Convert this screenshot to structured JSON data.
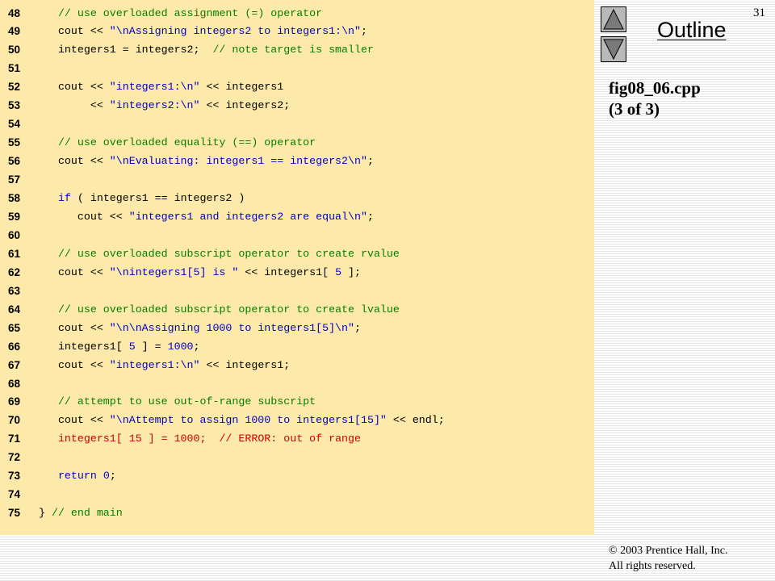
{
  "slide": {
    "page_number": "31",
    "outline_label": "Outline",
    "figure_name": "fig08_06.cpp",
    "figure_part": "(3 of 3)",
    "copyright_line1": "© 2003 Prentice Hall, Inc.",
    "copyright_line2": "All rights reserved.",
    "nav_up_icon": "triangle-up-icon",
    "nav_down_icon": "triangle-down-icon"
  },
  "code": [
    {
      "n": "48",
      "parts": [
        [
          "   ",
          ""
        ],
        [
          "// use overloaded assignment (=) operator",
          "cm"
        ]
      ]
    },
    {
      "n": "49",
      "parts": [
        [
          "   cout << ",
          ""
        ],
        [
          "\"\\nAssigning integers2 to integers1:\\n\"",
          "st"
        ],
        [
          ";",
          ""
        ]
      ]
    },
    {
      "n": "50",
      "parts": [
        [
          "   integers1 = integers2;  ",
          ""
        ],
        [
          "// note target is smaller",
          "cm"
        ]
      ]
    },
    {
      "n": "51",
      "parts": [
        [
          "",
          ""
        ]
      ]
    },
    {
      "n": "52",
      "parts": [
        [
          "   cout << ",
          ""
        ],
        [
          "\"integers1:\\n\"",
          "st"
        ],
        [
          " << integers1",
          ""
        ]
      ]
    },
    {
      "n": "53",
      "parts": [
        [
          "        << ",
          ""
        ],
        [
          "\"integers2:\\n\"",
          "st"
        ],
        [
          " << integers2;",
          ""
        ]
      ]
    },
    {
      "n": "54",
      "parts": [
        [
          "",
          ""
        ]
      ]
    },
    {
      "n": "55",
      "parts": [
        [
          "   ",
          ""
        ],
        [
          "// use overloaded equality (==) operator",
          "cm"
        ]
      ]
    },
    {
      "n": "56",
      "parts": [
        [
          "   cout << ",
          ""
        ],
        [
          "\"\\nEvaluating: integers1 == integers2\\n\"",
          "st"
        ],
        [
          ";",
          ""
        ]
      ]
    },
    {
      "n": "57",
      "parts": [
        [
          "",
          ""
        ]
      ]
    },
    {
      "n": "58",
      "parts": [
        [
          "   ",
          ""
        ],
        [
          "if",
          "kw"
        ],
        [
          " ( integers1 == integers2 )",
          ""
        ]
      ]
    },
    {
      "n": "59",
      "parts": [
        [
          "      cout << ",
          ""
        ],
        [
          "\"integers1 and integers2 are equal\\n\"",
          "st"
        ],
        [
          ";",
          ""
        ]
      ]
    },
    {
      "n": "60",
      "parts": [
        [
          "",
          ""
        ]
      ]
    },
    {
      "n": "61",
      "parts": [
        [
          "   ",
          ""
        ],
        [
          "// use overloaded subscript operator to create rvalue",
          "cm"
        ]
      ]
    },
    {
      "n": "62",
      "parts": [
        [
          "   cout << ",
          ""
        ],
        [
          "\"\\nintegers1[5] is \"",
          "st"
        ],
        [
          " << integers1[ ",
          ""
        ],
        [
          "5",
          "nm"
        ],
        [
          " ];",
          ""
        ]
      ]
    },
    {
      "n": "63",
      "parts": [
        [
          "",
          ""
        ]
      ]
    },
    {
      "n": "64",
      "parts": [
        [
          "   ",
          ""
        ],
        [
          "// use overloaded subscript operator to create lvalue",
          "cm"
        ]
      ]
    },
    {
      "n": "65",
      "parts": [
        [
          "   cout << ",
          ""
        ],
        [
          "\"\\n\\nAssigning 1000 to integers1[5]\\n\"",
          "st"
        ],
        [
          ";",
          ""
        ]
      ]
    },
    {
      "n": "66",
      "parts": [
        [
          "   integers1[ ",
          ""
        ],
        [
          "5",
          "nm"
        ],
        [
          " ] = ",
          ""
        ],
        [
          "1000",
          "nm"
        ],
        [
          ";",
          ""
        ]
      ]
    },
    {
      "n": "67",
      "parts": [
        [
          "   cout << ",
          ""
        ],
        [
          "\"integers1:\\n\"",
          "st"
        ],
        [
          " << integers1;",
          ""
        ]
      ]
    },
    {
      "n": "68",
      "parts": [
        [
          "",
          ""
        ]
      ]
    },
    {
      "n": "69",
      "parts": [
        [
          "   ",
          ""
        ],
        [
          "// attempt to use out-of-range subscript",
          "cm"
        ]
      ]
    },
    {
      "n": "70",
      "parts": [
        [
          "   cout << ",
          ""
        ],
        [
          "\"\\nAttempt to assign 1000 to integers1[15]\"",
          "st"
        ],
        [
          " << endl;",
          ""
        ]
      ]
    },
    {
      "n": "71",
      "parts": [
        [
          "   integers1[ 15 ] = 1000;  ",
          "er"
        ],
        [
          "// ERROR",
          "ec"
        ],
        [
          ": out of range",
          "er"
        ]
      ]
    },
    {
      "n": "72",
      "parts": [
        [
          "",
          ""
        ]
      ]
    },
    {
      "n": "73",
      "parts": [
        [
          "   ",
          ""
        ],
        [
          "return",
          "kw"
        ],
        [
          " ",
          ""
        ],
        [
          "0",
          "nm"
        ],
        [
          ";",
          ""
        ]
      ]
    },
    {
      "n": "74",
      "parts": [
        [
          "",
          ""
        ]
      ]
    },
    {
      "n": "75",
      "parts": [
        [
          "} ",
          ""
        ],
        [
          "// end main",
          "cm"
        ]
      ]
    }
  ]
}
